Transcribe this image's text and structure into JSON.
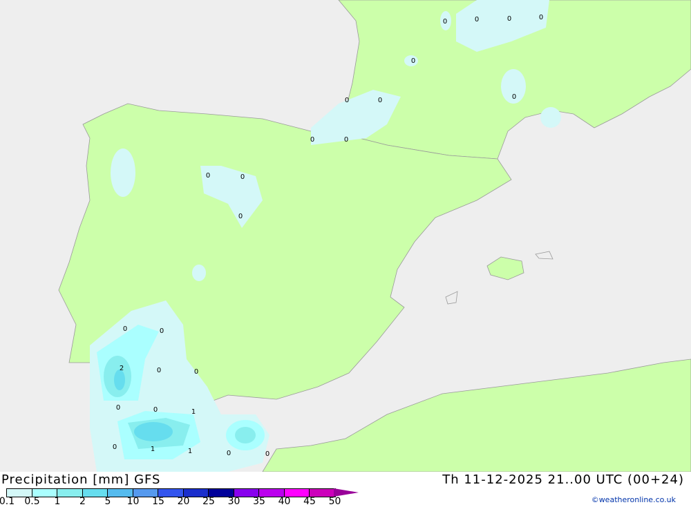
{
  "title": "Precipitation [mm] GFS",
  "valid_time": "Th 11-12-2025 21..00 UTC (00+24)",
  "credit": "©weatheronline.co.uk",
  "colors": {
    "sea": "#eeeeee",
    "land": "#ccffaa",
    "border": "#999999"
  },
  "legend": {
    "ticks": [
      "0.1",
      "0.5",
      "1",
      "2",
      "5",
      "10",
      "15",
      "20",
      "25",
      "30",
      "35",
      "40",
      "45",
      "50"
    ],
    "colors": [
      "#d4f8f8",
      "#aaffff",
      "#88eeee",
      "#66ddee",
      "#55bbee",
      "#5599ee",
      "#3355ee",
      "#1a2ecc",
      "#000099",
      "#8800ee",
      "#bb00ee",
      "#ff00ff",
      "#cc00bb"
    ]
  },
  "map_labels": [
    "0",
    "0",
    "0",
    "0",
    "0",
    "0",
    "0",
    "0",
    "0",
    "0",
    "0",
    "0",
    "0",
    "0",
    "0",
    "2",
    "0",
    "0",
    "0",
    "0",
    "1",
    "0",
    "1",
    "1",
    "0",
    "0"
  ]
}
